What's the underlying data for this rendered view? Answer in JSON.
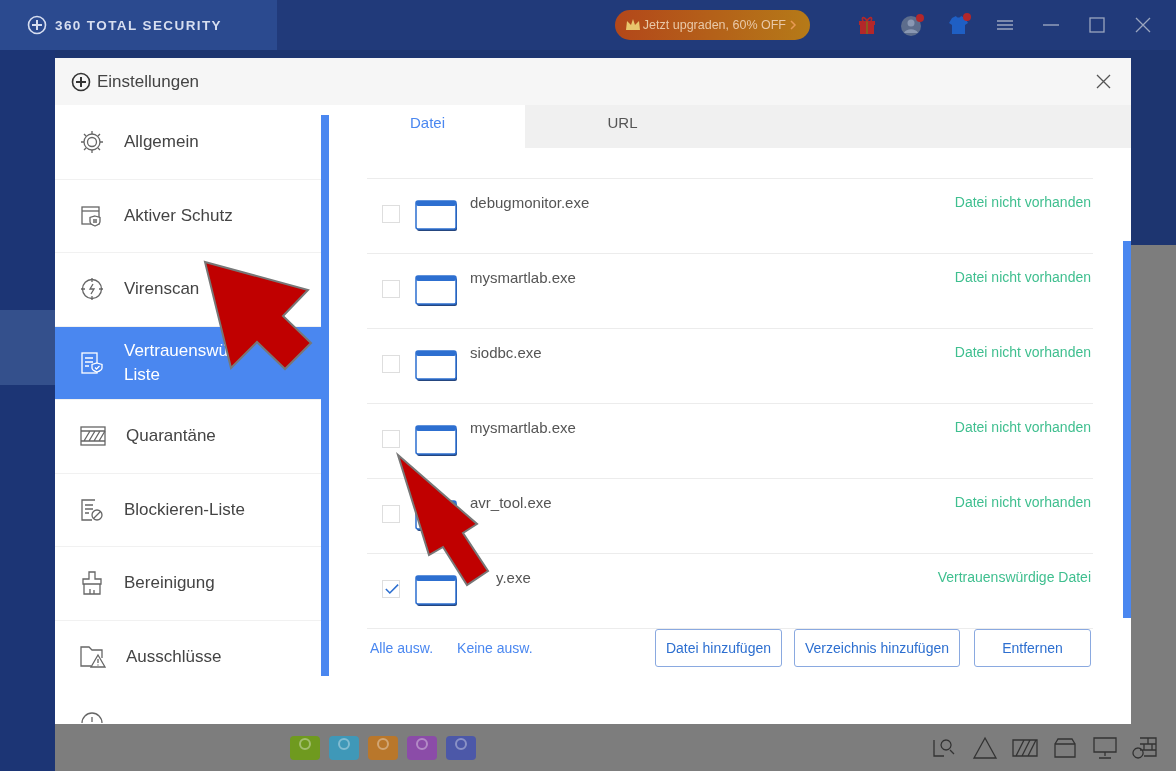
{
  "app": {
    "title": "360 TOTAL SECURITY",
    "upgrade": "Jetzt upgraden, 60% OFF"
  },
  "dialog": {
    "title": "Einstellungen",
    "nav": [
      {
        "label": "Allgemein",
        "selected": false
      },
      {
        "label": "Aktiver Schutz",
        "selected": false
      },
      {
        "label": "Virenscan",
        "selected": false
      },
      {
        "label": "Vertrauenswü\nListe",
        "selected": true
      },
      {
        "label": "Quarantäne",
        "selected": false
      },
      {
        "label": "Blockieren-Liste",
        "selected": false
      },
      {
        "label": "Bereinigung",
        "selected": false
      },
      {
        "label": "Ausschlüsse",
        "selected": false
      }
    ],
    "tabs": [
      {
        "label": "Datei",
        "selected": true
      },
      {
        "label": "URL",
        "selected": false
      }
    ],
    "files": [
      {
        "name": "debugmonitor.exe",
        "status": "Datei nicht vorhanden",
        "checked": false
      },
      {
        "name": "mysmartlab.exe",
        "status": "Datei nicht vorhanden",
        "checked": false
      },
      {
        "name": "siodbc.exe",
        "status": "Datei nicht vorhanden",
        "checked": false
      },
      {
        "name": "mysmartlab.exe",
        "status": "Datei nicht vorhanden",
        "checked": false
      },
      {
        "name": "avr_tool.exe",
        "status": "Datei nicht vorhanden",
        "checked": false
      },
      {
        "name": "y.exe",
        "status": "Vertrauenswürdige Datei",
        "checked": true
      }
    ],
    "links": [
      "Alle ausw.",
      "Keine ausw."
    ],
    "buttons": [
      "Datei hinzufügen",
      "Verzeichnis hinzufügen",
      "Entfernen"
    ]
  }
}
